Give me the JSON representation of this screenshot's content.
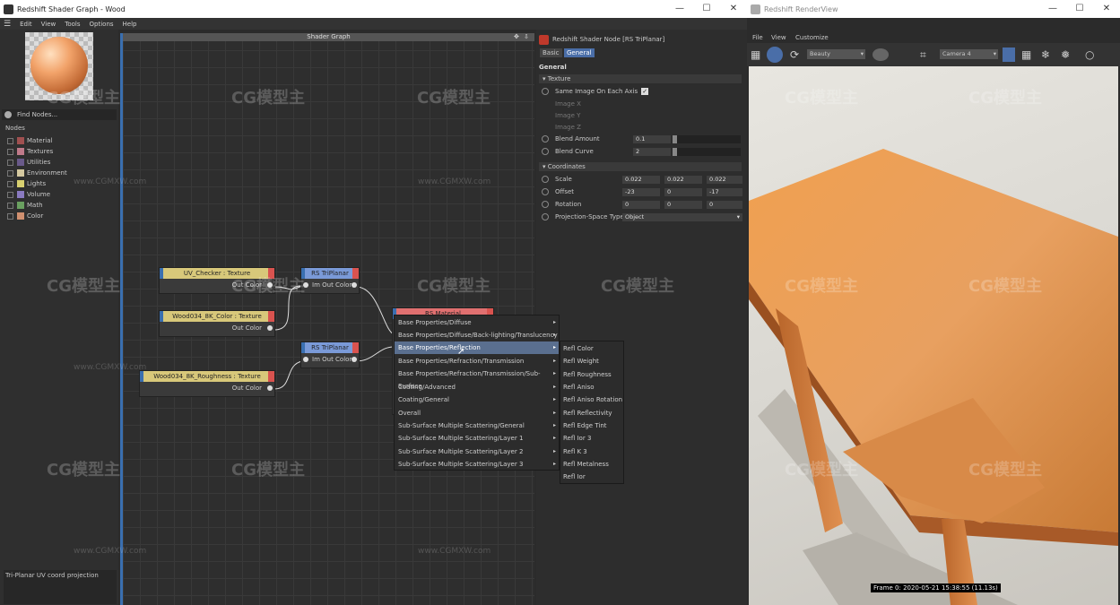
{
  "shader_window": {
    "title": "Redshift Shader Graph - Wood",
    "controls": [
      "—",
      "☐",
      "✕"
    ],
    "menu": [
      "Edit",
      "View",
      "Tools",
      "Options",
      "Help"
    ]
  },
  "left_panel": {
    "search_placeholder": "Find Nodes...",
    "nodes_label": "Nodes",
    "categories": [
      {
        "label": "Material",
        "color": "#a05050"
      },
      {
        "label": "Textures",
        "color": "#c07a8a"
      },
      {
        "label": "Utilities",
        "color": "#6a5a8a"
      },
      {
        "label": "Environment",
        "color": "#d4c8a0"
      },
      {
        "label": "Lights",
        "color": "#d8d070"
      },
      {
        "label": "Volume",
        "color": "#8a7ac0"
      },
      {
        "label": "Math",
        "color": "#6aa060"
      },
      {
        "label": "Color",
        "color": "#d09070"
      }
    ],
    "status": "Tri-Planar UV coord projection"
  },
  "graph": {
    "title": "Shader Graph",
    "nodes": [
      {
        "title": "UV_Checker : Texture",
        "port": "Out Color"
      },
      {
        "title": "Wood034_8K_Color : Texture",
        "port": "Out Color"
      },
      {
        "title": "Wood034_8K_Roughness : Texture",
        "port": "Out Color"
      },
      {
        "title": "RS TriPlanar",
        "port_in": "Im",
        "port_out": "Out Color"
      },
      {
        "title": "RS TriPlanar",
        "port_in": "Im",
        "port_out": "Out Color"
      },
      {
        "title": "RS Material"
      }
    ]
  },
  "context_menu": {
    "items": [
      "Base Properties/Diffuse",
      "Base Properties/Diffuse/Back-lighting/Translucency",
      "Base Properties/Reflection",
      "Base Properties/Refraction/Transmission",
      "Base Properties/Refraction/Transmission/Sub-Surface",
      "Coating/Advanced",
      "Coating/General",
      "Overall",
      "Sub-Surface Multiple Scattering/General",
      "Sub-Surface Multiple Scattering/Layer 1",
      "Sub-Surface Multiple Scattering/Layer 2",
      "Sub-Surface Multiple Scattering/Layer 3"
    ],
    "highlighted": "Base Properties/Reflection",
    "submenu": [
      "Refl Color",
      "Refl Weight",
      "Refl Roughness",
      "Refl Aniso",
      "Refl Aniso Rotation",
      "Refl Reflectivity",
      "Refl Edge Tint",
      "Refl Ior 3",
      "Refl K 3",
      "Refl Metalness",
      "Refl Ior"
    ]
  },
  "attributes": {
    "header": "Redshift Shader Node [RS TriPlanar]",
    "tabs": [
      "Basic",
      "General"
    ],
    "section_title": "General",
    "texture_group": "Texture",
    "same_image": "Same Image On Each Axis",
    "image_x": "Image X",
    "image_y": "Image Y",
    "image_z": "Image Z",
    "blend_amount_label": "Blend Amount",
    "blend_amount": "0.1",
    "blend_curve_label": "Blend Curve",
    "blend_curve": "2",
    "coords_group": "Coordinates",
    "scale_label": "Scale",
    "scale": [
      "0.022",
      "0.022",
      "0.022"
    ],
    "offset_label": "Offset",
    "offset": [
      "-23",
      "0",
      "-17"
    ],
    "rotation_label": "Rotation",
    "rotation": [
      "0",
      "0",
      "0"
    ],
    "proj_label": "Projection-Space Type",
    "proj_value": "Object"
  },
  "render_view": {
    "title": "Redshift RenderView",
    "controls": [
      "—",
      "☐",
      "✕"
    ],
    "menu": [
      "File",
      "View",
      "Customize"
    ],
    "aov": "Beauty",
    "camera": "Camera 4",
    "frame_info": "Frame 0: 2020-05-21 15:38:55 (11.13s)"
  },
  "watermark": {
    "brand": "CG模型主",
    "url": "www.CGMXW.com"
  }
}
